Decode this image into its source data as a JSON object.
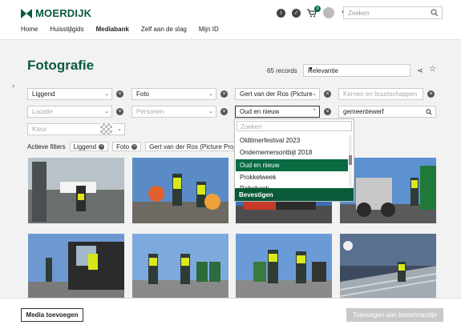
{
  "header": {
    "logo_text": "MOERDIJK",
    "nav": [
      "Home",
      "Huisstijlgids",
      "Mediabank",
      "Zelf aan de slag",
      "Mijn ID"
    ],
    "active_nav": "Mediabank",
    "cart_count": "0",
    "search_placeholder": "Zoeken"
  },
  "page": {
    "title": "Fotografie",
    "records": "65 records",
    "sort_value": "Relevantie"
  },
  "filters": {
    "row1": [
      {
        "value": "Liggend",
        "placeholder": false
      },
      {
        "value": "Foto",
        "placeholder": false
      },
      {
        "value": "Gert van der Ros (Picture",
        "placeholder": false
      },
      {
        "value": "Kernen en buurtschappen",
        "placeholder": true
      }
    ],
    "row2": [
      {
        "value": "Locatie",
        "placeholder": true
      },
      {
        "value": "Personen",
        "placeholder": true
      },
      {
        "value": "Oud en nieuw",
        "placeholder": false
      },
      {
        "value": "gemeentewerf",
        "placeholder": false
      }
    ],
    "color_placeholder": "Kleur"
  },
  "active_filters": {
    "label": "Actieve filters",
    "chips": [
      "Liggend",
      "Foto",
      "Gert van der Ros (Picture Project)"
    ]
  },
  "dropdown": {
    "search_placeholder": "Zoeken",
    "items": [
      "Oldtimerfestival 2023",
      "Ondernemersontbijt 2018",
      "Oud en nieuw",
      "Prokkelweek",
      "Rabobank"
    ],
    "selected": "Oud en nieuw",
    "confirm_label": "Bevestigen"
  },
  "footer": {
    "media_button": "Media toevoegen",
    "cart_button": "Toevoegen aan bestelmandje"
  },
  "colors": {
    "brand_green": "#0a5a3a",
    "selected_green": "#0a6b43"
  }
}
